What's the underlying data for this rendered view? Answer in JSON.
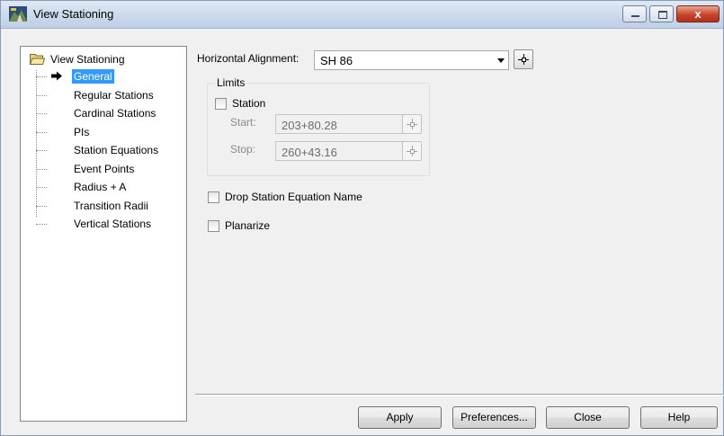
{
  "window": {
    "title": "View Stationing",
    "close_glyph": "x"
  },
  "tree": {
    "root_label": "View Stationing",
    "items": [
      {
        "label": "General",
        "selected": true
      },
      {
        "label": "Regular Stations"
      },
      {
        "label": "Cardinal Stations"
      },
      {
        "label": "PIs"
      },
      {
        "label": "Station Equations"
      },
      {
        "label": "Event Points"
      },
      {
        "label": "Radius + A"
      },
      {
        "label": "Transition Radii"
      },
      {
        "label": "Vertical Stations"
      }
    ]
  },
  "general": {
    "alignment_label": "Horizontal Alignment:",
    "alignment_value": "SH 86",
    "limits": {
      "group_label": "Limits",
      "station_label": "Station",
      "station_checked": false,
      "start_label": "Start:",
      "start_value": "203+80.28",
      "stop_label": "Stop:",
      "stop_value": "260+43.16"
    },
    "drop_equation_label": "Drop Station Equation Name",
    "drop_equation_checked": false,
    "planarize_label": "Planarize",
    "planarize_checked": false
  },
  "buttons": {
    "apply": "Apply",
    "preferences": "Preferences...",
    "close": "Close",
    "help": "Help"
  },
  "colors": {
    "selection": "#3399ff",
    "dialog_bg": "#f0f0f0",
    "close_button": "#c9432a"
  }
}
